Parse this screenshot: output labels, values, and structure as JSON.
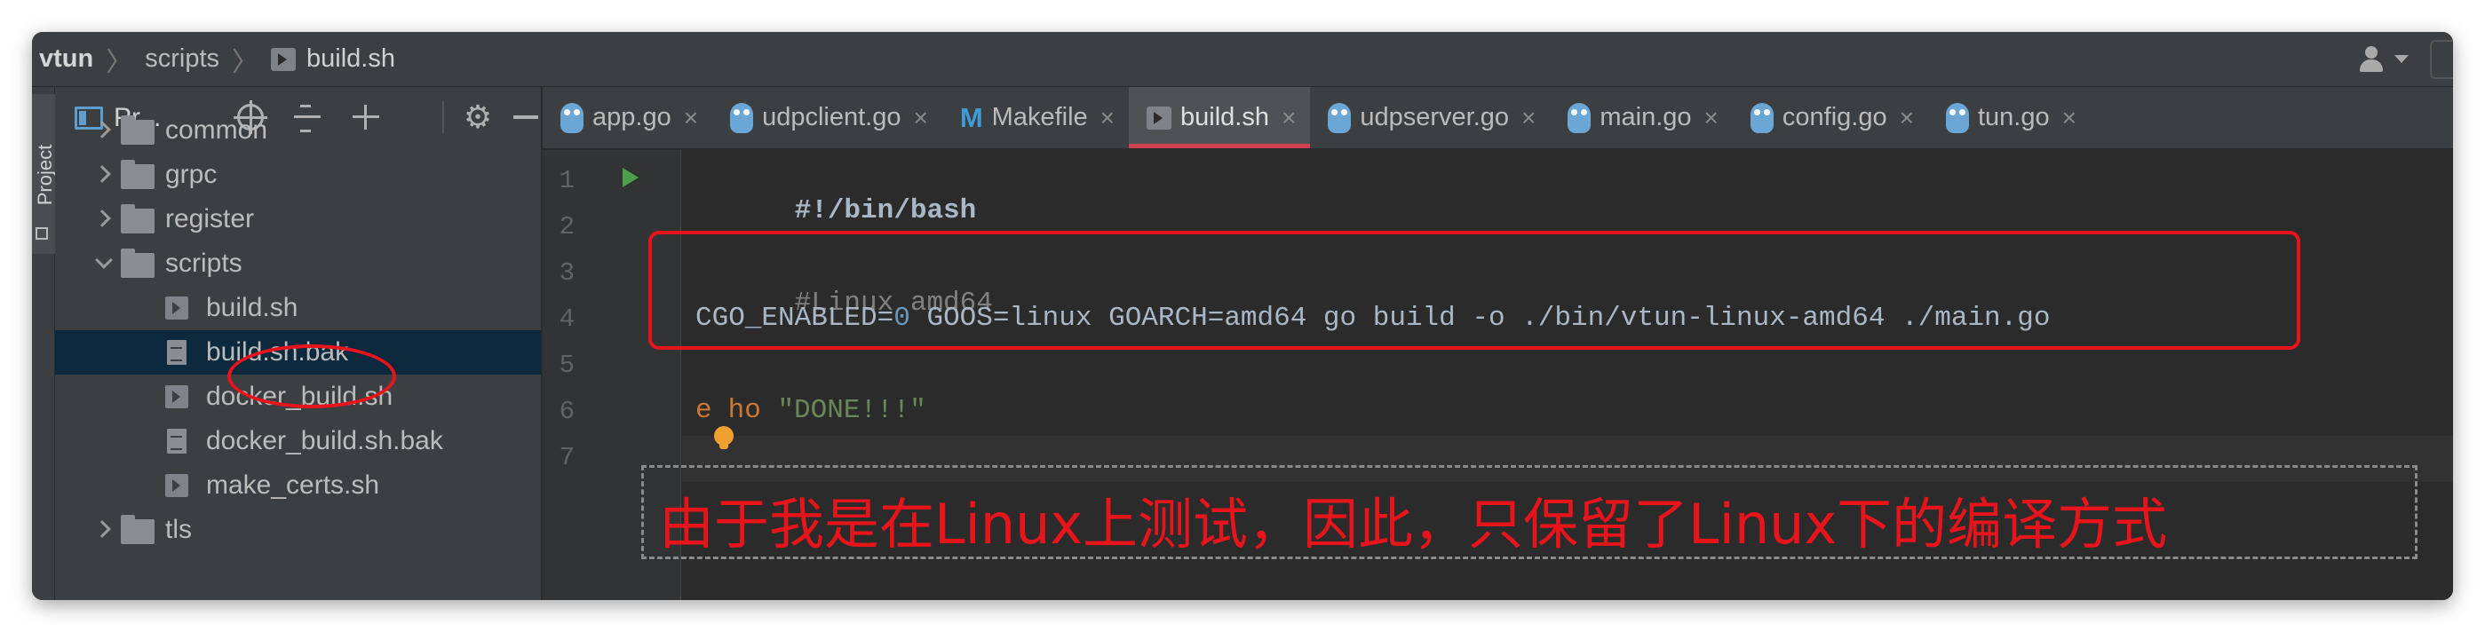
{
  "breadcrumb": {
    "root": "vtun",
    "folder": "scripts",
    "file": "build.sh"
  },
  "stripe": {
    "label": "Project"
  },
  "panel": {
    "title": "Pr..."
  },
  "tree": {
    "items": [
      {
        "label": "common",
        "kind": "folder",
        "state": "collapsed"
      },
      {
        "label": "grpc",
        "kind": "folder",
        "state": "collapsed"
      },
      {
        "label": "register",
        "kind": "folder",
        "state": "collapsed"
      },
      {
        "label": "scripts",
        "kind": "folder",
        "state": "expanded"
      },
      {
        "label": "build.sh",
        "kind": "sh"
      },
      {
        "label": "build.sh.bak",
        "kind": "text",
        "selected": true
      },
      {
        "label": "docker_build.sh",
        "kind": "sh"
      },
      {
        "label": "docker_build.sh.bak",
        "kind": "text"
      },
      {
        "label": "make_certs.sh",
        "kind": "sh"
      },
      {
        "label": "tls",
        "kind": "folder",
        "state": "collapsed"
      }
    ]
  },
  "tabs": [
    {
      "label": "app.go",
      "icon": "gopher-icon"
    },
    {
      "label": "udpclient.go",
      "icon": "gopher-icon"
    },
    {
      "label": "Makefile",
      "icon": "makefile-icon"
    },
    {
      "label": "build.sh",
      "icon": "shell-script-icon",
      "active": true
    },
    {
      "label": "udpserver.go",
      "icon": "gopher-icon"
    },
    {
      "label": "main.go",
      "icon": "gopher-icon"
    },
    {
      "label": "config.go",
      "icon": "gopher-icon"
    },
    {
      "label": "tun.go",
      "icon": "gopher-icon"
    }
  ],
  "tab_close": "×",
  "editor": {
    "line_numbers": [
      "1",
      "2",
      "3",
      "4",
      "5",
      "6",
      "7"
    ],
    "lines": {
      "l1": "#!/bin/bash",
      "l3": "#Linux amd64",
      "l4_a": "CGO_ENABLED=",
      "l4_num": "0",
      "l4_b": " GOOS=linux GOARCH=amd64 go build -o ./bin/vtun-linux-amd64 ./main.go",
      "l6_kw_a": "e",
      "l6_kw_b": "ho",
      "l6_str": "\"DONE!!!\""
    }
  },
  "annotation": {
    "text": "由于我是在Linux上测试，因此，只保留了Linux下的编译方式"
  },
  "colors": {
    "accent_red": "#e8141b",
    "tab_underline": "#d04050",
    "selection": "#0d293e"
  }
}
